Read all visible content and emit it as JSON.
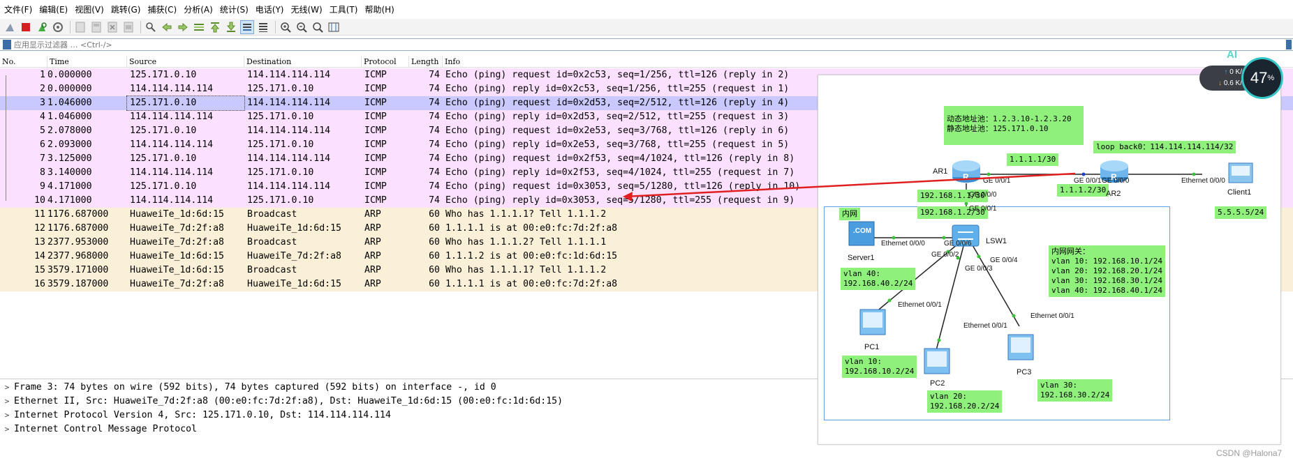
{
  "menu": [
    "文件(F)",
    "编辑(E)",
    "视图(V)",
    "跳转(G)",
    "捕获(C)",
    "分析(A)",
    "统计(S)",
    "电话(Y)",
    "无线(W)",
    "工具(T)",
    "帮助(H)"
  ],
  "toolbar": {
    "icons": [
      "shark-fin-icon",
      "stop-icon",
      "restart-icon",
      "options-icon",
      "open-icon",
      "save-icon",
      "close-file-icon",
      "reload-icon",
      "find-icon",
      "back-icon",
      "forward-icon",
      "goto-icon",
      "first-icon",
      "last-icon",
      "autoscroll-icon",
      "colorize-icon",
      "zoom-in-icon",
      "zoom-out-icon",
      "normal-size-icon",
      "resize-columns-icon"
    ]
  },
  "filter": {
    "placeholder": "应用显示过滤器 … <Ctrl-/>"
  },
  "columns": [
    "No.",
    "Time",
    "Source",
    "Destination",
    "Protocol",
    "Length",
    "Info"
  ],
  "packets": [
    {
      "no": "1",
      "time": "0.000000",
      "src": "125.171.0.10",
      "dst": "114.114.114.114",
      "proto": "ICMP",
      "len": "74",
      "info": "Echo (ping) request  id=0x2c53, seq=1/256, ttl=126 (reply in 2)",
      "kind": "icmp"
    },
    {
      "no": "2",
      "time": "0.000000",
      "src": "114.114.114.114",
      "dst": "125.171.0.10",
      "proto": "ICMP",
      "len": "74",
      "info": "Echo (ping) reply    id=0x2c53, seq=1/256, ttl=255 (request in 1)",
      "kind": "icmp"
    },
    {
      "no": "3",
      "time": "1.046000",
      "src": "125.171.0.10",
      "dst": "114.114.114.114",
      "proto": "ICMP",
      "len": "74",
      "info": "Echo (ping) request  id=0x2d53, seq=2/512, ttl=126 (reply in 4)",
      "kind": "selected"
    },
    {
      "no": "4",
      "time": "1.046000",
      "src": "114.114.114.114",
      "dst": "125.171.0.10",
      "proto": "ICMP",
      "len": "74",
      "info": "Echo (ping) reply    id=0x2d53, seq=2/512, ttl=255 (request in 3)",
      "kind": "icmp"
    },
    {
      "no": "5",
      "time": "2.078000",
      "src": "125.171.0.10",
      "dst": "114.114.114.114",
      "proto": "ICMP",
      "len": "74",
      "info": "Echo (ping) request  id=0x2e53, seq=3/768, ttl=126 (reply in 6)",
      "kind": "icmp"
    },
    {
      "no": "6",
      "time": "2.093000",
      "src": "114.114.114.114",
      "dst": "125.171.0.10",
      "proto": "ICMP",
      "len": "74",
      "info": "Echo (ping) reply    id=0x2e53, seq=3/768, ttl=255 (request in 5)",
      "kind": "icmp"
    },
    {
      "no": "7",
      "time": "3.125000",
      "src": "125.171.0.10",
      "dst": "114.114.114.114",
      "proto": "ICMP",
      "len": "74",
      "info": "Echo (ping) request  id=0x2f53, seq=4/1024, ttl=126 (reply in 8)",
      "kind": "icmp"
    },
    {
      "no": "8",
      "time": "3.140000",
      "src": "114.114.114.114",
      "dst": "125.171.0.10",
      "proto": "ICMP",
      "len": "74",
      "info": "Echo (ping) reply    id=0x2f53, seq=4/1024, ttl=255 (request in 7)",
      "kind": "icmp"
    },
    {
      "no": "9",
      "time": "4.171000",
      "src": "125.171.0.10",
      "dst": "114.114.114.114",
      "proto": "ICMP",
      "len": "74",
      "info": "Echo (ping) request  id=0x3053, seq=5/1280, ttl=126 (reply in 10)",
      "kind": "icmp"
    },
    {
      "no": "10",
      "time": "4.171000",
      "src": "114.114.114.114",
      "dst": "125.171.0.10",
      "proto": "ICMP",
      "len": "74",
      "info": "Echo (ping) reply    id=0x3053, seq=5/1280, ttl=255 (request in 9)",
      "kind": "icmp"
    },
    {
      "no": "11",
      "time": "1176.687000",
      "src": "HuaweiTe_1d:6d:15",
      "dst": "Broadcast",
      "proto": "ARP",
      "len": "60",
      "info": "Who has 1.1.1.1? Tell 1.1.1.2",
      "kind": "arp"
    },
    {
      "no": "12",
      "time": "1176.687000",
      "src": "HuaweiTe_7d:2f:a8",
      "dst": "HuaweiTe_1d:6d:15",
      "proto": "ARP",
      "len": "60",
      "info": "1.1.1.1 is at 00:e0:fc:7d:2f:a8",
      "kind": "arp"
    },
    {
      "no": "13",
      "time": "2377.953000",
      "src": "HuaweiTe_7d:2f:a8",
      "dst": "Broadcast",
      "proto": "ARP",
      "len": "60",
      "info": "Who has 1.1.1.2? Tell 1.1.1.1",
      "kind": "arp"
    },
    {
      "no": "14",
      "time": "2377.968000",
      "src": "HuaweiTe_1d:6d:15",
      "dst": "HuaweiTe_7d:2f:a8",
      "proto": "ARP",
      "len": "60",
      "info": "1.1.1.2 is at 00:e0:fc:1d:6d:15",
      "kind": "arp"
    },
    {
      "no": "15",
      "time": "3579.171000",
      "src": "HuaweiTe_1d:6d:15",
      "dst": "Broadcast",
      "proto": "ARP",
      "len": "60",
      "info": "Who has 1.1.1.1? Tell 1.1.1.2",
      "kind": "arp"
    },
    {
      "no": "16",
      "time": "3579.187000",
      "src": "HuaweiTe_7d:2f:a8",
      "dst": "HuaweiTe_1d:6d:15",
      "proto": "ARP",
      "len": "60",
      "info": "1.1.1.1 is at 00:e0:fc:7d:2f:a8",
      "kind": "arp"
    }
  ],
  "details": [
    "Frame 3: 74 bytes on wire (592 bits), 74 bytes captured (592 bits) on interface -, id 0",
    "Ethernet II, Src: HuaweiTe_7d:2f:a8 (00:e0:fc:7d:2f:a8), Dst: HuaweiTe_1d:6d:15 (00:e0:fc:1d:6d:15)",
    "Internet Protocol Version 4, Src: 125.171.0.10, Dst: 114.114.114.114",
    "Internet Control Message Protocol"
  ],
  "topology": {
    "nat_pool": "动态地址池：1.2.3.10-1.2.3.20\n静态地址池：125.171.0.10",
    "loopback": "loop back0：114.114.114.114/32",
    "ar1_label": "AR1",
    "ar2_label": "AR2",
    "lsw1_label": "LSW1",
    "client1_label": "Client1",
    "server1_label": "Server1",
    "pc1_label": "PC1",
    "pc2_label": "PC2",
    "pc3_label": "PC3",
    "ar1_ge001": "GE 0/0/1",
    "ar1_ge000": "GE 0/0/0",
    "ar2_ge001": "GE 0/0/1",
    "ar2_ge000": "GE 0/0/0",
    "client_eth": "Ethernet 0/0/0",
    "lsw_ge001": "GE 0/0/1",
    "lsw_ge006": "GE 0/0/6",
    "lsw_ge002": "GE 0/0/2",
    "lsw_ge003": "GE 0/0/3",
    "lsw_ge004": "GE 0/0/4",
    "server_eth": "Ethernet 0/0/0",
    "pc1_eth": "Ethernet 0/0/1",
    "pc2_eth": "Ethernet 0/0/1",
    "pc3_eth": "Ethernet 0/0/1",
    "ar1_ip_wan": "1.1.1.1/30",
    "ar2_ip_wan": "1.1.1.2/30",
    "ar1_ip_lan": "192.168.1.1/30",
    "lsw_ip_up": "192.168.1.2/30",
    "client_ip": "5.5.5.5/24",
    "lan_title": "内网",
    "server_vlan": "vlan 40:\n192.168.40.2/24",
    "pc1_vlan": "vlan 10:\n192.168.10.2/24",
    "pc2_vlan": "vlan 20:\n192.168.20.2/24",
    "pc3_vlan": "vlan 30:\n192.168.30.2/24",
    "gateways": "内网网关：\nvlan 10: 192.168.10.1/24\nvlan 20: 192.168.20.1/24\nvlan 30: 192.168.30.1/24\nvlan 40: 192.168.40.1/24",
    "server_badge": ".COM"
  },
  "netmon": {
    "up": "0 K/s",
    "down": "0.6 K/s",
    "cpu": "47",
    "cpu_unit": "%",
    "ai": "AI"
  },
  "watermark": "CSDN @Halona7",
  "colors": {
    "icmp_row": "#fce0ff",
    "arp_row": "#faf0d7",
    "selected_row": "#c9c8ff",
    "green_box": "#8ff07c",
    "arrow_red": "#e02020"
  }
}
